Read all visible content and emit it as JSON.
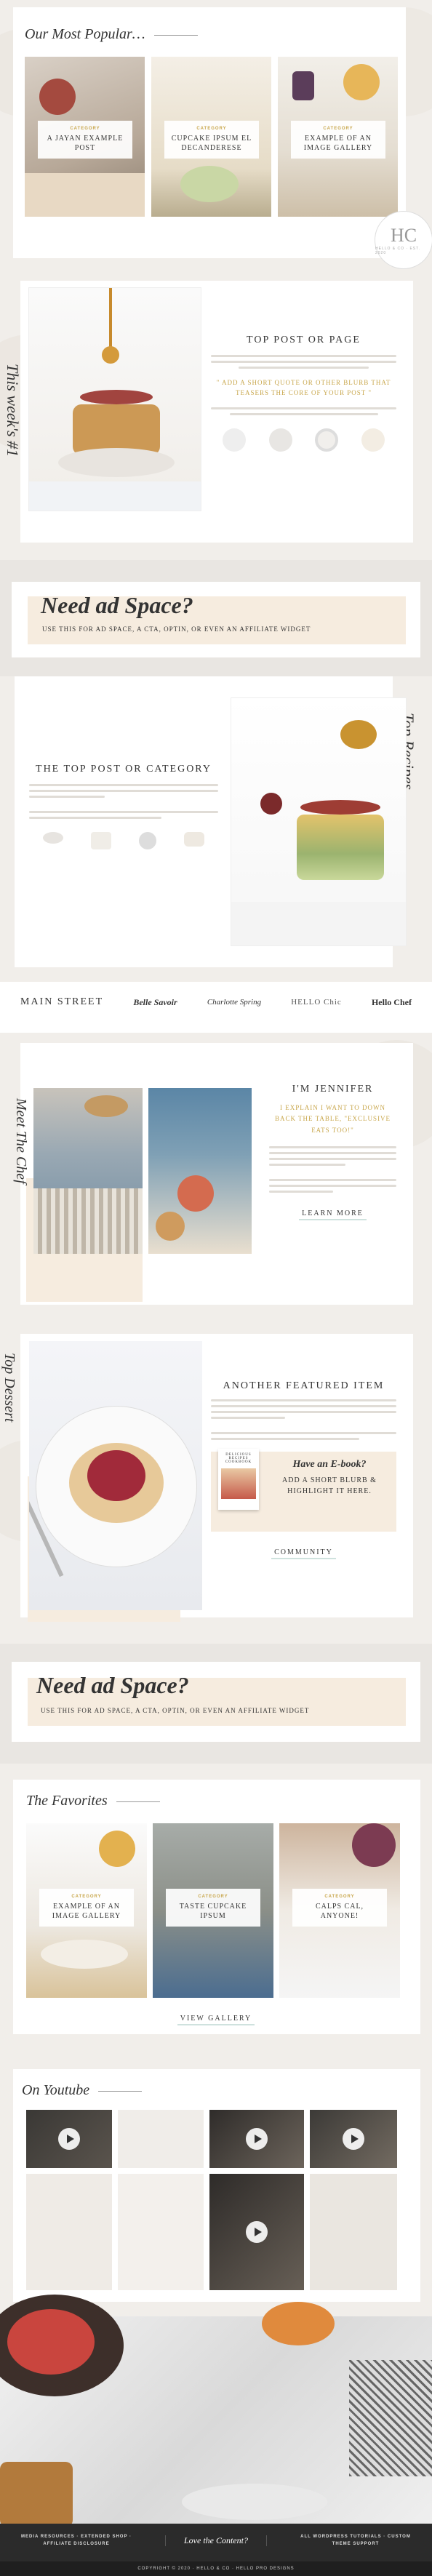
{
  "popular": {
    "heading": "Our Most Popular…",
    "posts": [
      {
        "category": "CATEGORY",
        "title": "A JAYAN EXAMPLE POST"
      },
      {
        "category": "CATEGORY",
        "title": "CUPCAKE IPSUM EL DECANDERESE"
      },
      {
        "category": "CATEGORY",
        "title": "EXAMPLE OF AN IMAGE GALLERY"
      }
    ],
    "badge_initials": "HC",
    "badge_text": "HELLO & CO · EST. 2020"
  },
  "this_week": {
    "vertical_title": "This week's #1",
    "title": "TOP POST OR PAGE",
    "quote": "\" ADD A SHORT QUOTE OR OTHER BLURB THAT TEASERS THE CORE OF YOUR POST \""
  },
  "ad1": {
    "title": "Need ad Space?",
    "subtitle": "USE THIS FOR AD SPACE, A CTA, OPTIN, OR EVEN AN AFFILIATE WIDGET"
  },
  "top_recipes": {
    "vertical_title": "Top Recipes",
    "title": "THE TOP POST OR CATEGORY"
  },
  "logos": [
    "MAIN STREET",
    "Belle Savoir",
    "Charlotte Spring",
    "HELLO Chic",
    "Hello Chef"
  ],
  "chef": {
    "vertical_title": "Meet The Chef",
    "title": "I'M JENNIFER",
    "quote": "I EXPLAIN I WANT TO DOWN BACK THE TABLE, \"EXCLUSIVE EATS TOO!\"",
    "button": "LEARN MORE"
  },
  "dessert": {
    "vertical_title": "Top Dessert",
    "title": "ANOTHER FEATURED ITEM",
    "ebook_label": "Have an E-book?",
    "ebook_text": "ADD A SHORT BLURB & HIGHLIGHT IT HERE.",
    "ebook_cover": "DELICIOUS RECIPES COOKBOOK",
    "button": "COMMUNITY"
  },
  "ad2": {
    "title": "Need ad Space?",
    "subtitle": "USE THIS FOR AD SPACE, A CTA, OPTIN, OR EVEN AN AFFILIATE WIDGET"
  },
  "favorites": {
    "heading": "The Favorites",
    "posts": [
      {
        "category": "CATEGORY",
        "title": "EXAMPLE OF AN IMAGE GALLERY"
      },
      {
        "category": "CATEGORY",
        "title": "TASTE CUPCAKE IPSUM"
      },
      {
        "category": "CATEGORY",
        "title": "CALPS CAL, ANYONE!"
      }
    ],
    "button": "VIEW GALLERY"
  },
  "youtube": {
    "heading": "On Youtube"
  },
  "footer": {
    "col1": "MEDIA RESOURCES · EXTENDED SHOP · AFFILIATE DISCLOSURE",
    "middle": "Love the Content?",
    "col3": "ALL WORDPRESS TUTORIALS · CUSTOM THEME SUPPORT",
    "copyright": "COPYRIGHT © 2020 · HELLO & CO · HELLO PRO DESIGNS"
  },
  "colors": {
    "accent": "#c8a64b",
    "blush": "#f6ecdf",
    "mint": "#cfe2de",
    "dark": "#333333"
  }
}
